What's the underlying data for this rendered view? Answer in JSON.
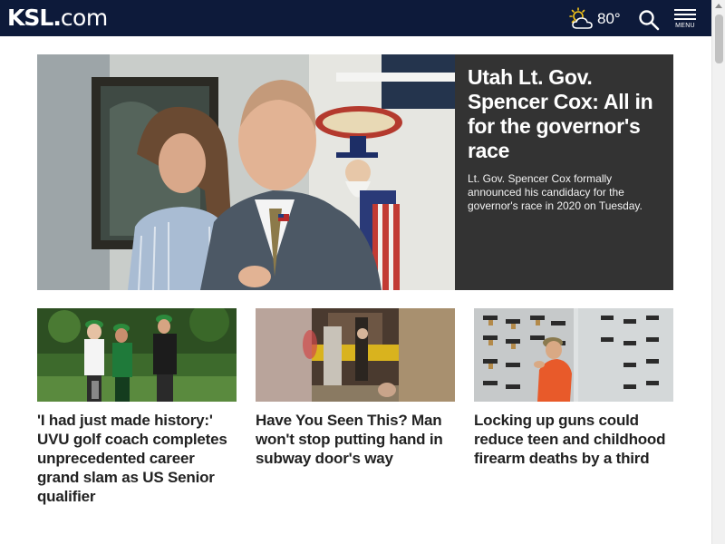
{
  "header": {
    "logo": "KSL.com",
    "logo_main": "KSL",
    "logo_dot": ".",
    "logo_tld": "com",
    "weather_icon": "partly-cloudy-icon",
    "temperature": "80°",
    "search_icon": "search-icon",
    "menu_label": "MENU",
    "background": "#0d1a3a"
  },
  "hero": {
    "title": "Utah Lt. Gov. Spencer Cox: All in for the governor's race",
    "subtitle": "Lt. Gov. Spencer Cox formally announced his candidacy for the governor's race in 2020 on Tuesday.",
    "panel_color": "#333333"
  },
  "cards": [
    {
      "title": "'I had just made history:' UVU golf coach completes unprecedented career grand slam as US Senior qualifier"
    },
    {
      "title": "Have You Seen This? Man won't stop putting hand in subway door's way"
    },
    {
      "title": "Locking up guns could reduce teen and childhood firearm deaths by a third"
    }
  ]
}
